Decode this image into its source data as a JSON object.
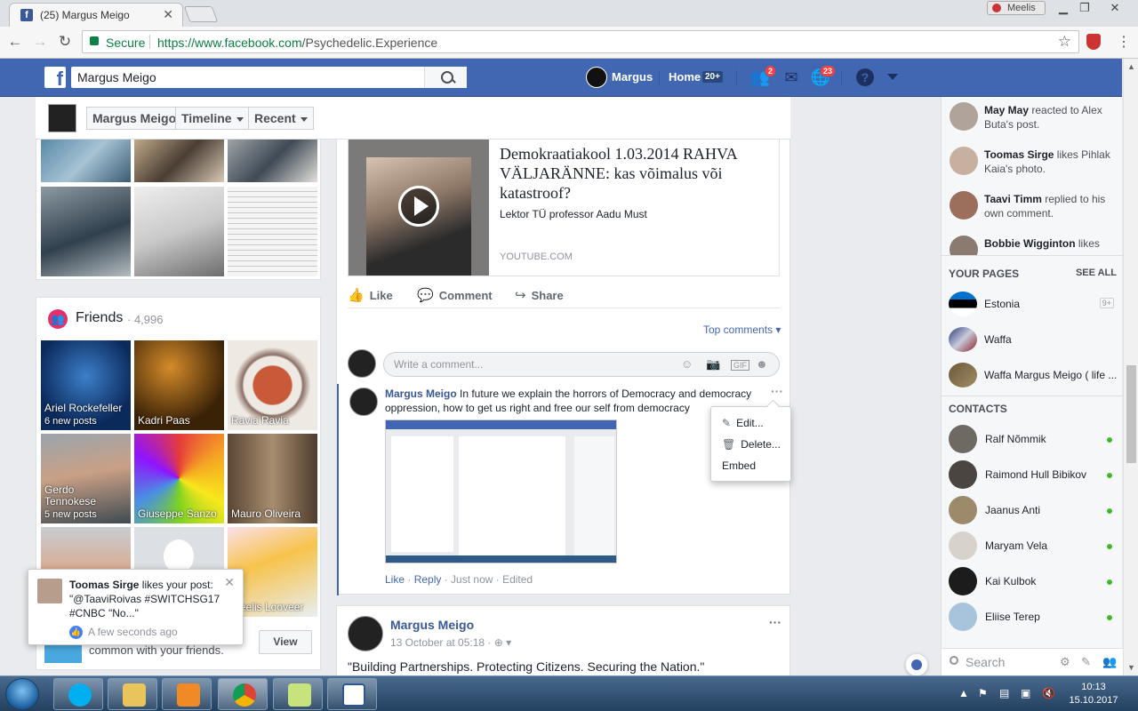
{
  "browser": {
    "tab_title": "(25) Margus Meigo",
    "user_badge": "Meelis",
    "secure_label": "Secure",
    "url_host": "https://www.facebook.com",
    "url_path": "/Psychedelic.Experience"
  },
  "fb": {
    "search_value": "Margus Meigo",
    "me_name": "Margus",
    "home_label": "Home",
    "home_count": "20+",
    "friend_requests_count": "2",
    "notifications_count": "23"
  },
  "profile_nav": {
    "name": "Margus Meigo",
    "timeline": "Timeline",
    "recent": "Recent"
  },
  "friends": {
    "title": "Friends",
    "count": "· 4,996",
    "tiles": [
      {
        "name": "Ariel Rockefeller",
        "posts": "6 new posts"
      },
      {
        "name": "Kadri Paas",
        "posts": ""
      },
      {
        "name": "Ravia Ravia",
        "posts": ""
      },
      {
        "name": "Gerdo Tennokese",
        "posts": "5 new posts"
      },
      {
        "name": "Giuseppe Sanzo",
        "posts": ""
      },
      {
        "name": "Mauro Oliveira",
        "posts": ""
      },
      {
        "name": "",
        "posts": ""
      },
      {
        "name": "",
        "posts": ""
      },
      {
        "name": "Meelis Looveer",
        "posts": ""
      }
    ],
    "common_text": "common with your friends.",
    "view_button": "View"
  },
  "toast": {
    "actor": "Toomas Sirge",
    "text": " likes your post: \"@TaaviRoivas #SWITCHSG17 #CNBC \"No...\"",
    "time": "A few seconds ago"
  },
  "post1": {
    "link_title": "Demokraatiakool 1.03.2014 RAHVA VÄLJARÄNNE: kas võimalus või katastroof?",
    "link_desc": "Lektor TÜ professor Aadu Must",
    "link_source": "YOUTUBE.COM",
    "like": "Like",
    "comment": "Comment",
    "share": "Share",
    "top_comments": "Top comments",
    "comment_placeholder": "Write a comment...",
    "comment_author": "Margus Meigo",
    "comment_text": " In future we explain the horrors of Democracy and democracy oppression, how to get us right and free our self from democracy",
    "c_like": "Like",
    "c_reply": "Reply",
    "c_time": "Just now",
    "c_edited": "Edited",
    "menu": {
      "edit": "Edit...",
      "delete": "Delete...",
      "embed": "Embed"
    }
  },
  "post2": {
    "author": "Margus Meigo",
    "date": "13 October at 05:18 ·",
    "text": "\"Building Partnerships. Protecting Citizens. Securing the Nation.\""
  },
  "ticker": [
    {
      "actor": "May May",
      "rest": " reacted to Alex Buta's post."
    },
    {
      "actor": "Toomas Sirge",
      "rest": " likes Pihlak Kaia's photo."
    },
    {
      "actor": "Taavi Timm",
      "rest": " replied to his own comment."
    },
    {
      "actor": "Bobbie Wigginton",
      "rest": " likes"
    }
  ],
  "pages": {
    "header": "YOUR PAGES",
    "see_all": "SEE ALL",
    "items": [
      {
        "name": "Estonia",
        "badge": "9+"
      },
      {
        "name": "Waffa",
        "badge": ""
      },
      {
        "name": "Waffa Margus Meigo ( life ...",
        "badge": ""
      }
    ]
  },
  "contacts": {
    "header": "CONTACTS",
    "items": [
      "Ralf Nõmmik",
      "Raimond Hull Bibikov",
      "Jaanus Anti",
      "Maryam Vela",
      "Kai Kulbok",
      "Eliise Terep"
    ],
    "search_placeholder": "Search"
  },
  "taskbar": {
    "time": "10:13",
    "date": "15.10.2017"
  }
}
